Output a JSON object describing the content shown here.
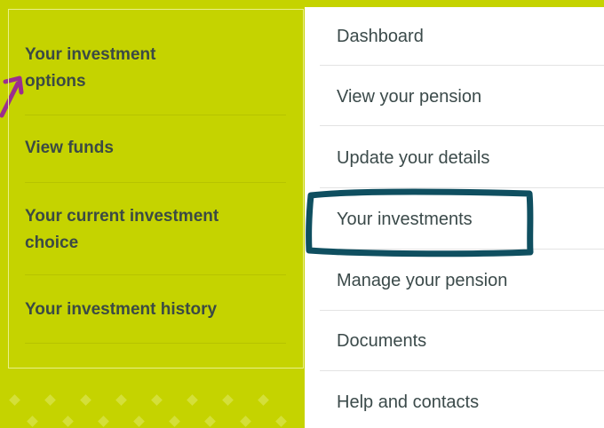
{
  "left_menu": {
    "items": [
      {
        "label_line1": "Your investment",
        "label_line2": "options"
      },
      {
        "label_line1": "View funds",
        "label_line2": ""
      },
      {
        "label_line1": "Your current investment",
        "label_line2": "choice"
      },
      {
        "label_line1": "Your investment history",
        "label_line2": ""
      }
    ]
  },
  "main_nav": {
    "items": [
      "Dashboard",
      "View your pension",
      "Update your details",
      "Your investments",
      "Manage your pension",
      "Documents",
      "Help and contacts"
    ],
    "highlighted_item": "Your investments"
  },
  "colors": {
    "background": "#c5d300",
    "menu_text": "#3b4a44",
    "highlight_stroke": "#0f4f60",
    "arrow_stroke": "#9b2d8f"
  }
}
